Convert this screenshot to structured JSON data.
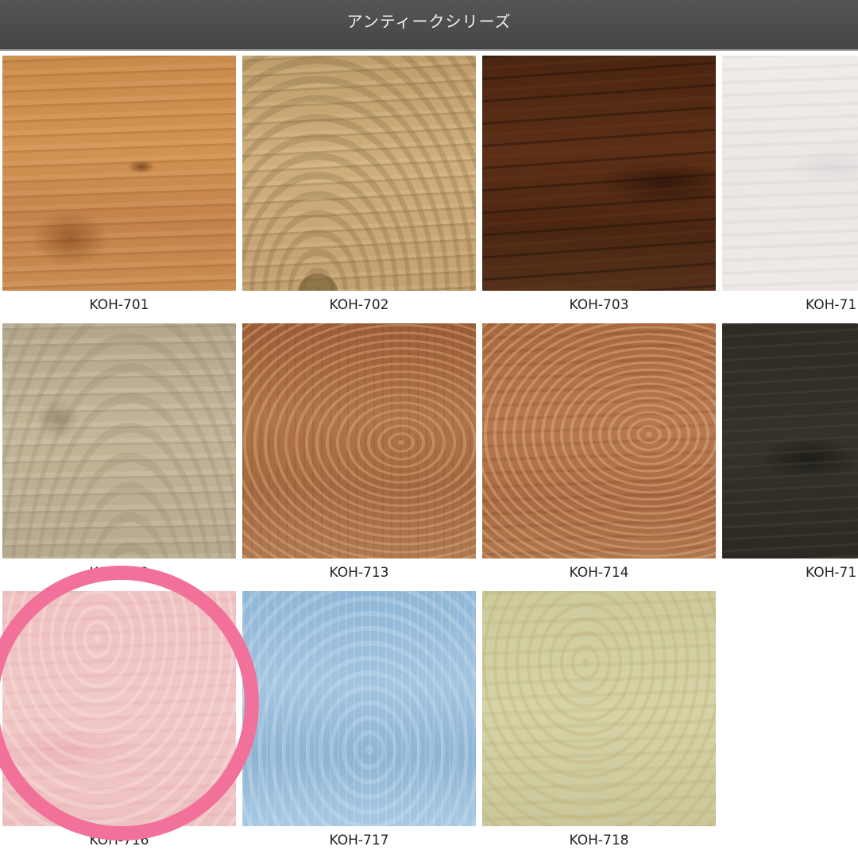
{
  "header": {
    "title": "アンティークシリーズ"
  },
  "colors": {
    "header_background": "#4a4a4a",
    "highlight_ring": "#f2719a"
  },
  "swatches": [
    {
      "code": "KOH-701",
      "color": "#c98a4a"
    },
    {
      "code": "KOH-702",
      "color": "#c6a574"
    },
    {
      "code": "KOH-703",
      "color": "#522a14"
    },
    {
      "code": "KOH-71",
      "color": "#eee8e6"
    },
    {
      "code": "KOH-712",
      "color": "#b9ac90"
    },
    {
      "code": "KOH-713",
      "color": "#a86c43"
    },
    {
      "code": "KOH-714",
      "color": "#b07449"
    },
    {
      "code": "KOH-71",
      "color": "#302e26"
    },
    {
      "code": "KOH-716",
      "color": "#efc4c4"
    },
    {
      "code": "KOH-717",
      "color": "#98bcda"
    },
    {
      "code": "KOH-718",
      "color": "#d0cea1"
    }
  ],
  "highlighted_swatch": "KOH-716"
}
